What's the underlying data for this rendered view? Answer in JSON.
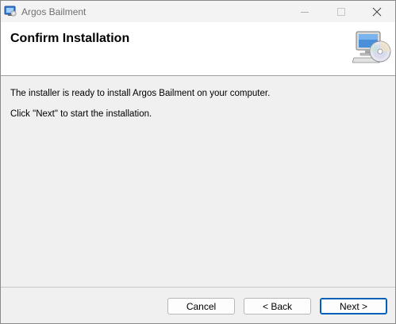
{
  "window": {
    "title": "Argos Bailment",
    "controls": {
      "minimize_icon": "minimize-icon",
      "maximize_icon": "maximize-icon",
      "close_icon": "close-icon"
    }
  },
  "header": {
    "title": "Confirm Installation",
    "art_icon": "computer-cd-icon"
  },
  "body": {
    "line1": "The installer is ready to install Argos Bailment on your computer.",
    "line2": "Click \"Next\" to start the installation."
  },
  "buttons": {
    "cancel": "Cancel",
    "back": "< Back",
    "next": "Next >"
  },
  "colors": {
    "accent": "#005fb8",
    "window_bg": "#f0f0f0",
    "header_bg": "#ffffff"
  }
}
